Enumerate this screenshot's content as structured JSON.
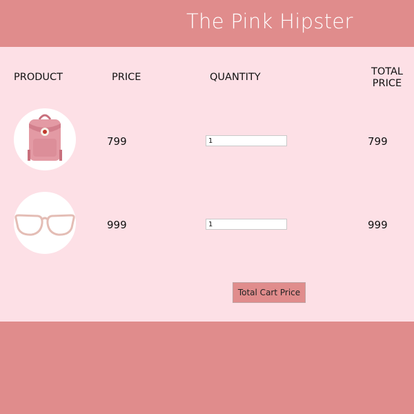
{
  "header": {
    "title": "The Pink Hipster"
  },
  "table": {
    "columns": [
      "PRODUCT",
      "PRICE",
      "QUANTITY",
      "TOTAL\nPRICE"
    ],
    "rows": [
      {
        "image": "backpack-image",
        "price": "799",
        "quantity": "1",
        "total": "799"
      },
      {
        "image": "glasses-image",
        "price": "999",
        "quantity": "1",
        "total": "999"
      }
    ]
  },
  "cart": {
    "total_button_label": "Total Cart Price"
  },
  "colors": {
    "header_bg": "#e08c8c",
    "content_bg": "#fde0e6",
    "button_bg": "#e08c8c"
  }
}
